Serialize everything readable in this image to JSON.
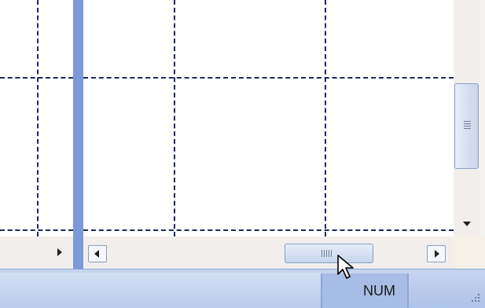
{
  "status_bar": {
    "num_lock_label": "NUM"
  },
  "colors": {
    "grid_line": "#1c2a5e",
    "split_bar": "#7c9ad8",
    "status_bar": "#b8cbed"
  },
  "icons": {
    "cursor": "arrow-cursor-icon",
    "scroll_left": "arrow-left-icon",
    "scroll_right": "arrow-right-icon",
    "scroll_down": "arrow-down-icon",
    "resize": "resize-grip-icon"
  }
}
